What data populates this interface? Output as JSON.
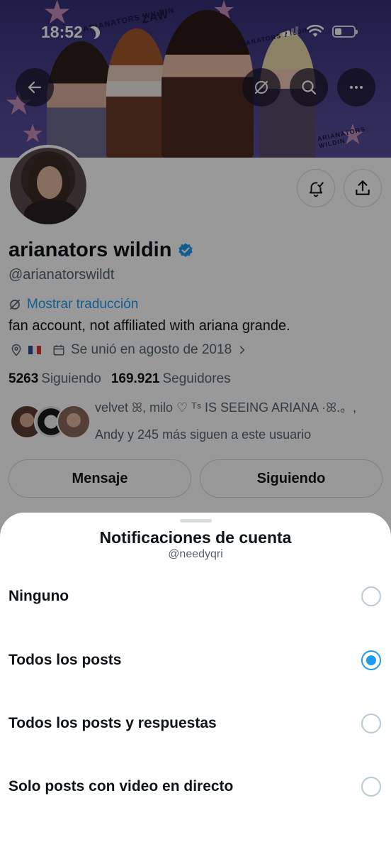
{
  "status_bar": {
    "time": "18:52"
  },
  "banner": {
    "scribbles": [
      "ARIANATORS WILDIN",
      "ZAW",
      "ARIANATORS WILDIN",
      "ARIANATORS WILDIN"
    ]
  },
  "profile": {
    "display_name": "arianators wildin",
    "handle": "@arianatorswildt",
    "translate_label": "Mostrar traducción",
    "bio": "fan account, not affiliated with ariana grande.",
    "joined": "Se unió en agosto de 2018",
    "following_count": "5263",
    "following_label": "Siguiendo",
    "followers_count": "169.921",
    "followers_label": "Seguidores",
    "followed_by_line1": "velvet ꕤ, milo ♡ ᵀˢ IS SEEING ARIANA ·ꕤ.。,",
    "followed_by_line2": "Andy y 245 más siguen a este usuario",
    "message_button": "Mensaje",
    "following_button": "Siguiendo",
    "verified_color": "#1d9bf0"
  },
  "sheet": {
    "title": "Notificaciones de cuenta",
    "subtitle": "@needyqri",
    "options": [
      {
        "label": "Ninguno",
        "selected": false
      },
      {
        "label": "Todos los posts",
        "selected": true
      },
      {
        "label": "Todos los posts y respuestas",
        "selected": false
      },
      {
        "label": "Solo posts con video en directo",
        "selected": false
      }
    ]
  },
  "colors": {
    "accent": "#1d9bf0",
    "banner": "#3d3580"
  },
  "icons": [
    "back-arrow-icon",
    "translate-icon",
    "search-icon",
    "more-icon",
    "bell-icon",
    "share-icon",
    "location-icon",
    "calendar-icon",
    "chevron-right-icon",
    "verified-icon",
    "moon-icon",
    "signal-icon",
    "wifi-icon",
    "battery-icon"
  ]
}
